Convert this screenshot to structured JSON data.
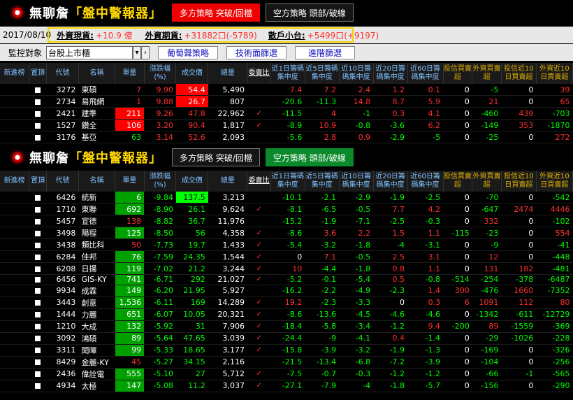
{
  "app": {
    "brand": "無聊詹",
    "title_open": "「",
    "title_main": "盤中警報器",
    "title_close": "」"
  },
  "tabs": {
    "long": "多方策略 突破/回檔",
    "short": "空方策略 頭部/破線"
  },
  "info": {
    "date": "2017/08/10",
    "foreign_spot_label": "外資現貨:",
    "foreign_spot_value": "+10.9 億",
    "foreign_fut_label": "外資期貨:",
    "foreign_fut_value": "+31882口(-5789)",
    "retail_label": "散戶小台:",
    "retail_value": "+5499口(+9197)"
  },
  "ctrl": {
    "label": "監控對象",
    "market": "台股上市櫃",
    "b1": "葡萄聲策略",
    "b2": "技術面篩選",
    "b3": "進階篩選"
  },
  "cols": [
    "新進榜",
    "置頂",
    "代號",
    "名稱",
    "單量",
    "漲跌幅(%)",
    "成交價",
    "總量",
    "委買委賣比",
    "近1日籌碼集中度",
    "近5日籌碼集中度",
    "近10日籌碼集中度",
    "近20日籌碼集中度",
    "近60日籌碼集中度",
    "投信買賣超",
    "外資買賣超",
    "投信近10日買賣超",
    "外資近10日買賣超"
  ],
  "cols_disp": [
    "新進榜",
    "置頂",
    "代號",
    "名稱",
    "單量",
    "漲跌幅(%)",
    "成交價",
    "總量",
    "委賣比",
    "近1日籌碼集中度",
    "近5日籌碼集中度",
    "近10日籌碼集中度",
    "近20日籌碼集中度",
    "近60日籌碼集中度",
    "投信買賣超",
    "外資買賣超",
    "投信近10日買賣超",
    "外資近10日買賣超"
  ],
  "top_rows": [
    [
      "3272",
      "東碩",
      "7",
      "9.90",
      "54.4",
      "5,490",
      "",
      "7.4",
      "7.2",
      "2.4",
      "1.2",
      "0.1",
      "0",
      "-5",
      "0",
      "39"
    ],
    [
      "2734",
      "易飛網",
      "1",
      "9.88",
      "26.7",
      "807",
      "",
      "-20.6",
      "-11.3",
      "14.8",
      "8.7",
      "5.9",
      "0",
      "21",
      "0",
      "65"
    ],
    [
      "2421",
      "建準",
      "211",
      "9.26",
      "47.8",
      "22,962",
      "✓",
      "-11.5",
      "4",
      "-1",
      "0.3",
      "4.1",
      "0",
      "-460",
      "439",
      "-703"
    ],
    [
      "1527",
      "鑽全",
      "106",
      "3.20",
      "90.4",
      "1,817",
      "✓",
      "-8.9",
      "10.9",
      "-0.8",
      "-3.6",
      "6.2",
      "0",
      "-149",
      "353",
      "-1870"
    ],
    [
      "3176",
      "基亞",
      "63",
      "3.14",
      "52.6",
      "2,093",
      "",
      "-5.6",
      "2.8",
      "0.9",
      "-2.9",
      "-5",
      "0",
      "-25",
      "0",
      "272"
    ]
  ],
  "bottom_rows": [
    [
      "6426",
      "統新",
      "6",
      "-9.84",
      "137.5",
      "3,213",
      "",
      "-10.1",
      "-2.1",
      "-2.9",
      "-1.9",
      "-2.5",
      "0",
      "-70",
      "0",
      "-542"
    ],
    [
      "1710",
      "東聯",
      "692",
      "-8.90",
      "26.1",
      "9,624",
      "✓",
      "-8.1",
      "-6.5",
      "-0.5",
      "7.7",
      "4.2",
      "0",
      "-647",
      "2474",
      "4446"
    ],
    [
      "5457",
      "宣德",
      "138",
      "-8.82",
      "36.7",
      "11,976",
      "",
      "-15.2",
      "-1.9",
      "-7.1",
      "-2.5",
      "-0.3",
      "0",
      "332",
      "0",
      "-102"
    ],
    [
      "3498",
      "陽程",
      "125",
      "-8.50",
      "56",
      "4,358",
      "✓",
      "-8.6",
      "3.6",
      "2.2",
      "1.5",
      "1.1",
      "-115",
      "-23",
      "0",
      "554"
    ],
    [
      "3438",
      "類比科",
      "50",
      "-7.73",
      "19.7",
      "1,433",
      "✓",
      "-5.4",
      "-3.2",
      "-1.8",
      "-4",
      "-3.1",
      "0",
      "-9",
      "0",
      "-41"
    ],
    [
      "6284",
      "佳邦",
      "76",
      "-7.59",
      "24.35",
      "1,544",
      "✓",
      "0",
      "7.1",
      "-0.5",
      "2.5",
      "3.1",
      "0",
      "12",
      "0",
      "-448"
    ],
    [
      "6208",
      "日揚",
      "119",
      "-7.02",
      "21.2",
      "3,244",
      "✓",
      "10",
      "-4.4",
      "-1.8",
      "0.8",
      "1.1",
      "0",
      "131",
      "182",
      "-481"
    ],
    [
      "6456",
      "GIS-KY",
      "741",
      "-6.71",
      "292",
      "21,027",
      "✓",
      "-5.2",
      "-0.1",
      "-5.4",
      "0.5",
      "-0.8",
      "-514",
      "-254",
      "-378",
      "-6487"
    ],
    [
      "9934",
      "成霖",
      "149",
      "-6.20",
      "21.95",
      "5,927",
      "",
      "-16.2",
      "-2.2",
      "-4.9",
      "-2.3",
      "1.4",
      "300",
      "-476",
      "1660",
      "-7352"
    ],
    [
      "3443",
      "創意",
      "1,536",
      "-6.11",
      "169",
      "14,289",
      "✓",
      "19.2",
      "-2.3",
      "-3.3",
      "0",
      "0.3",
      "6",
      "1091",
      "112",
      "80"
    ],
    [
      "1444",
      "力麗",
      "651",
      "-6.07",
      "10.05",
      "20,321",
      "✓",
      "-8.6",
      "-13.6",
      "-4.5",
      "-4.6",
      "-4.6",
      "0",
      "-1342",
      "-611",
      "-12729"
    ],
    [
      "1210",
      "大成",
      "132",
      "-5.92",
      "31",
      "7,906",
      "✓",
      "-18.4",
      "-5.8",
      "-3.4",
      "-1.2",
      "9.4",
      "-200",
      "89",
      "-1559",
      "-369"
    ],
    [
      "3092",
      "鴻碩",
      "89",
      "-5.64",
      "47.65",
      "3,039",
      "✓",
      "-24.4",
      "-9",
      "-4.1",
      "0.4",
      "-1.4",
      "0",
      "-29",
      "-1026",
      "-228"
    ],
    [
      "3311",
      "閎暉",
      "99",
      "-5.33",
      "18.65",
      "3,177",
      "✓",
      "-15.8",
      "-3.9",
      "-3.2",
      "-1.9",
      "-1.3",
      "0",
      "-169",
      "0",
      "-326"
    ],
    [
      "8429",
      "金麗-KY",
      "45",
      "-5.27",
      "34.15",
      "2,116",
      "",
      "-21.5",
      "-13.4",
      "-6.8",
      "-7.2",
      "-3.9",
      "0",
      "-104",
      "0",
      "-256"
    ],
    [
      "2436",
      "偉詮電",
      "555",
      "-5.10",
      "27",
      "5,712",
      "✓",
      "-7.5",
      "-0.7",
      "-0.3",
      "-1.2",
      "-1.2",
      "0",
      "-66",
      "-1",
      "-565"
    ],
    [
      "4934",
      "太極",
      "147",
      "-5.08",
      "11.2",
      "3,037",
      "✓",
      "-27.1",
      "-7.9",
      "-4",
      "-1.8",
      "-5.7",
      "0",
      "-156",
      "0",
      "-290"
    ]
  ]
}
